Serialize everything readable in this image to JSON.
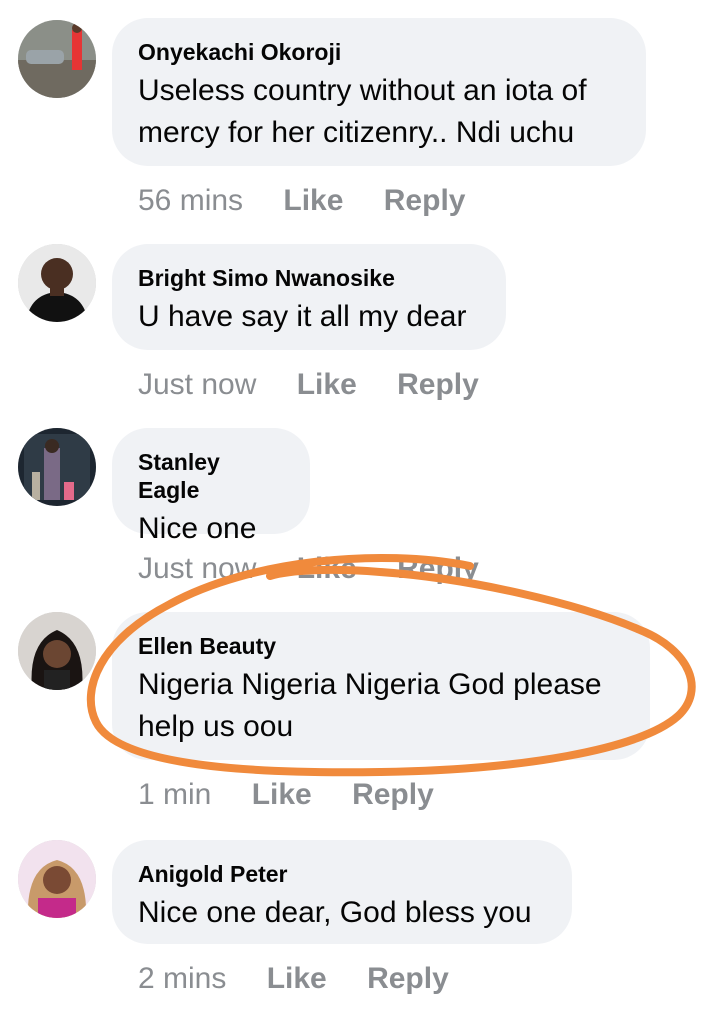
{
  "comments": [
    {
      "author": "Onyekachi Okoroji",
      "text": "Useless country without an iota of mercy for her citizenry.. Ndi uchu",
      "time": "56 mins",
      "like": "Like",
      "reply": "Reply"
    },
    {
      "author": "Bright Simo Nwanosike",
      "text": "U have say it all my dear",
      "time": "Just now",
      "like": "Like",
      "reply": "Reply"
    },
    {
      "author": "Stanley Eagle",
      "text": "Nice one",
      "time": "Just now",
      "like": "Like",
      "reply": "Reply"
    },
    {
      "author": "Ellen Beauty",
      "text": "Nigeria Nigeria Nigeria God please help us oou",
      "time": "1 min",
      "like": "Like",
      "reply": "Reply"
    },
    {
      "author": "Anigold Peter",
      "text": "Nice one dear, God bless you",
      "time": "2 mins",
      "like": "Like",
      "reply": "Reply"
    }
  ],
  "colors": {
    "bubble": "#f0f2f5",
    "highlight": "#f08a3c",
    "meta": "#8a8d91"
  }
}
